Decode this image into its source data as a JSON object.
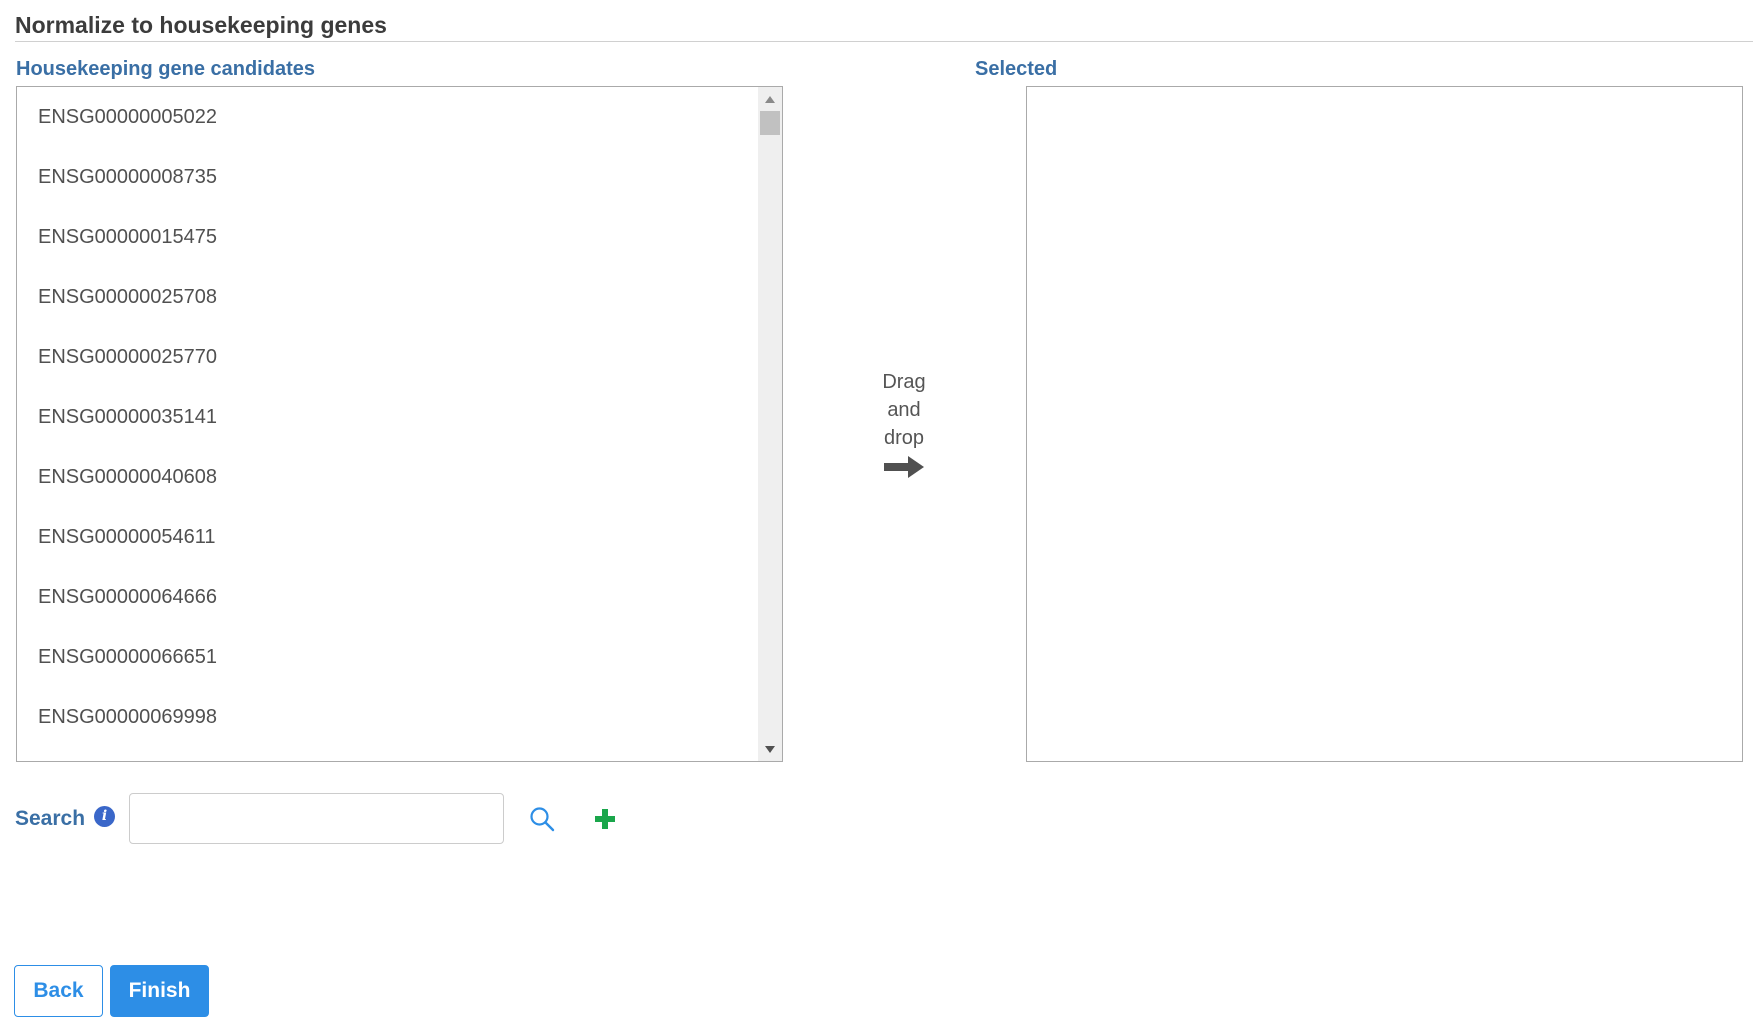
{
  "page": {
    "title": "Normalize to housekeeping genes"
  },
  "candidates": {
    "label": "Housekeeping gene candidates",
    "items": [
      "ENSG00000005022",
      "ENSG00000008735",
      "ENSG00000015475",
      "ENSG00000025708",
      "ENSG00000025770",
      "ENSG00000035141",
      "ENSG00000040608",
      "ENSG00000054611",
      "ENSG00000064666",
      "ENSG00000066651",
      "ENSG00000069998"
    ]
  },
  "drag_hint": {
    "line1": "Drag",
    "line2": "and",
    "line3": "drop",
    "icon": "arrow-right-icon"
  },
  "selected": {
    "label": "Selected",
    "items": []
  },
  "search": {
    "label": "Search",
    "value": "",
    "placeholder": "",
    "info_icon": "info-icon",
    "search_icon": "search-icon",
    "add_icon": "plus-icon"
  },
  "footer": {
    "back_label": "Back",
    "finish_label": "Finish"
  },
  "colors": {
    "label_blue": "#3a6fa5",
    "primary_button": "#2d8ee6",
    "add_icon_green": "#1aa64b",
    "info_icon_blue": "#3a67c9"
  }
}
